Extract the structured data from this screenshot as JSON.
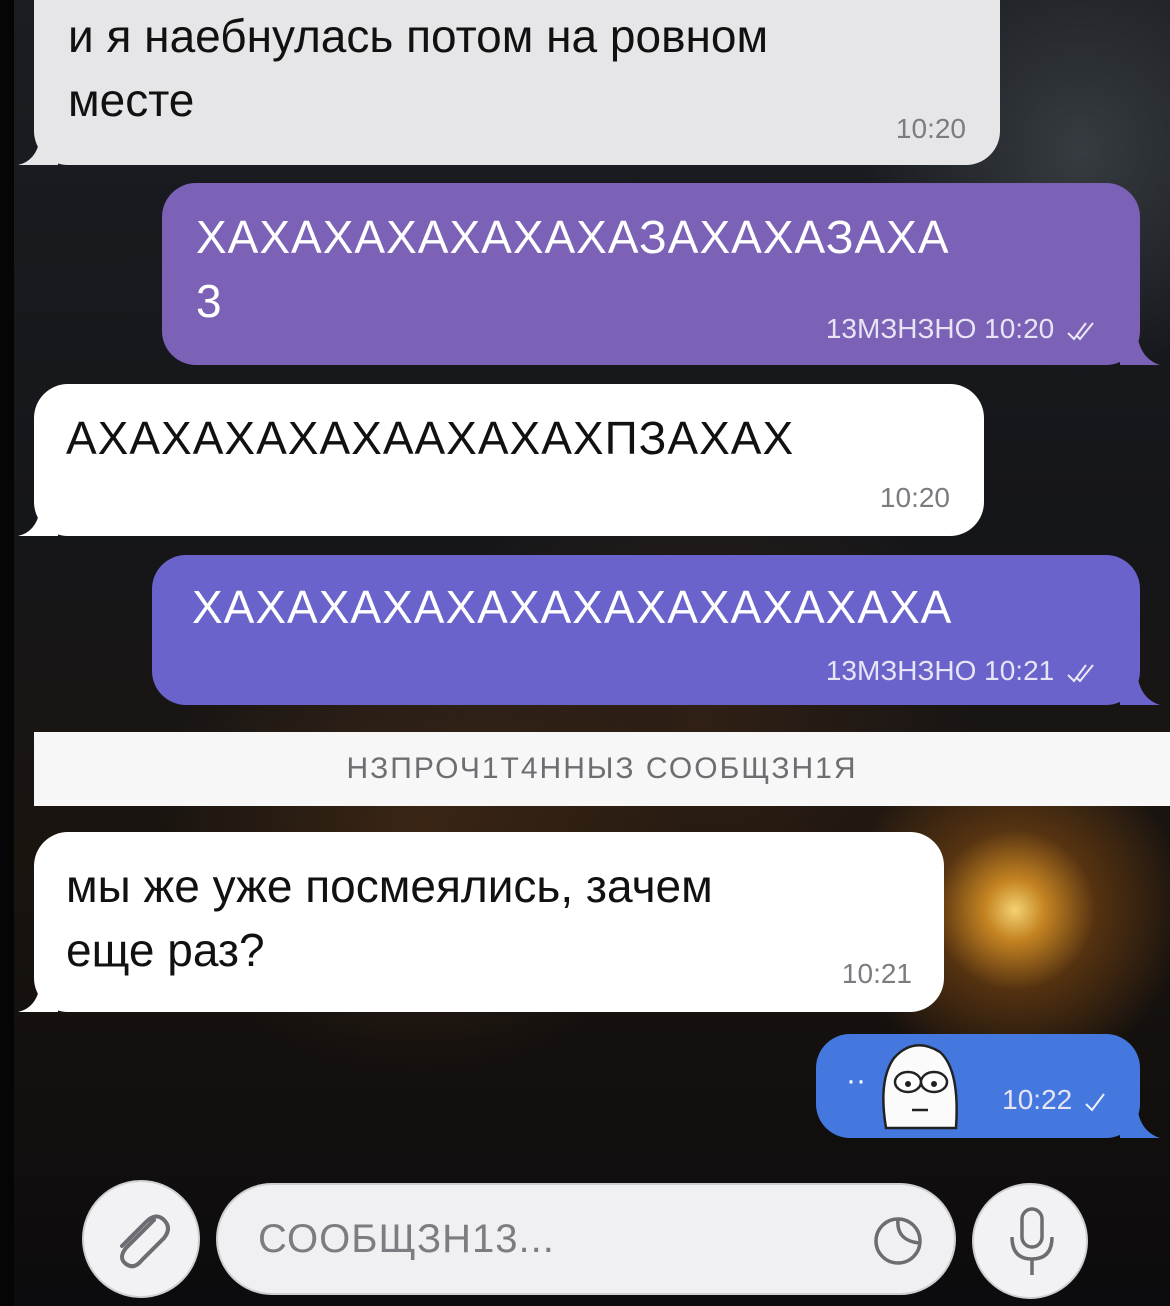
{
  "messages": [
    {
      "text": "и я наебнулась потом на ровном\nместе",
      "time": "10:20"
    },
    {
      "text": "ХАХАХАХАХАХАХАЗАХАХАЗАХА\n3",
      "status": "13МЗНЗНО",
      "time": "10:20"
    },
    {
      "text": "АХАХАХАХАХААХАХАХПЗАХАХ",
      "time": "10:20"
    },
    {
      "text": "ХАХАХАХАХАХАХАХАХАХАХАХА",
      "status": "13МЗНЗНО",
      "time": "10:21"
    },
    {
      "text": "мы же уже посмеялись, зачем\nеще раз?",
      "time": "10:21"
    },
    {
      "prefix": "··",
      "sticker": "worried-face",
      "time": "10:22"
    }
  ],
  "unread_divider": "НЗПРОЧ1Т4ННЫЗ СООБЩЗН1Я",
  "composer": {
    "placeholder": "СООБЩЗН13...",
    "attach_icon": "paperclip-icon",
    "sticker_icon": "sticker-icon",
    "mic_icon": "microphone-icon"
  },
  "colors": {
    "incoming": "#ffffff",
    "outgoing_purple": "#7b62b6",
    "outgoing_indigo": "#6a63cb",
    "outgoing_blue": "#4478de"
  }
}
